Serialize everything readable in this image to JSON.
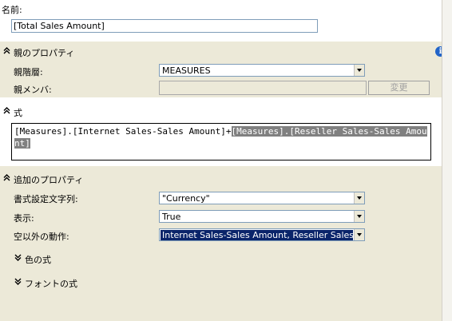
{
  "name_section": {
    "label": "名前:",
    "value": "[Total Sales Amount]"
  },
  "parent_props": {
    "header": "親のプロパティ",
    "hierarchy_label": "親階層:",
    "hierarchy_value": "MEASURES",
    "member_label": "親メンバ:",
    "member_value": "",
    "change_button": "変更"
  },
  "expression": {
    "header": "式",
    "text_plain": "[Measures].[Internet Sales-Sales Amount]+",
    "text_selected": "[Measures].[Reseller Sales-Sales Amount]"
  },
  "additional_props": {
    "header": "追加のプロパティ",
    "format_label": "書式設定文字列:",
    "format_value": "\"Currency\"",
    "visible_label": "表示:",
    "visible_value": "True",
    "nonempty_label": "空以外の動作:",
    "nonempty_value": "Internet Sales-Sales Amount, Reseller Sales..."
  },
  "color_expr": {
    "label": "色の式"
  },
  "font_expr": {
    "label": "フォントの式"
  },
  "icons": {
    "collapse": "double-chevron-up-icon",
    "expand": "double-chevron-down-icon",
    "info": "info-icon"
  },
  "colors": {
    "panel_gray": "#ece9d8",
    "selection": "#0a246a",
    "info_blue": "#2164c8"
  }
}
